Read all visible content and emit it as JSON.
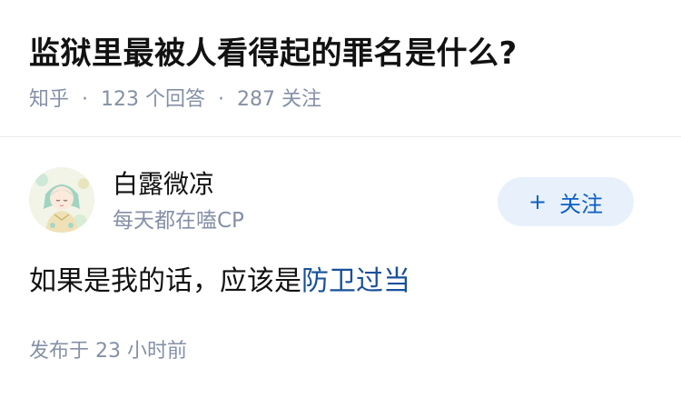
{
  "question": {
    "title": "监狱里最被人看得起的罪名是什么?",
    "source": "知乎",
    "answer_count": "123",
    "answer_label": "个回答",
    "follower_count": "287",
    "follower_label": "关注"
  },
  "author": {
    "name": "白露微凉",
    "bio": "每天都在嗑CP",
    "avatar_icon": "illustrated-avatar-icon",
    "follow_label": "关注",
    "follow_icon": "plus-icon"
  },
  "answer": {
    "text_before": "如果是我的话，应该是",
    "link_text": "防卫过当"
  },
  "publish": {
    "label": "发布于",
    "time": "23 小时前"
  },
  "colors": {
    "title": "#121212",
    "meta": "#8590a6",
    "link": "#175199",
    "follow_bg": "#e8f1fb",
    "follow_text": "#0d5fc4"
  }
}
